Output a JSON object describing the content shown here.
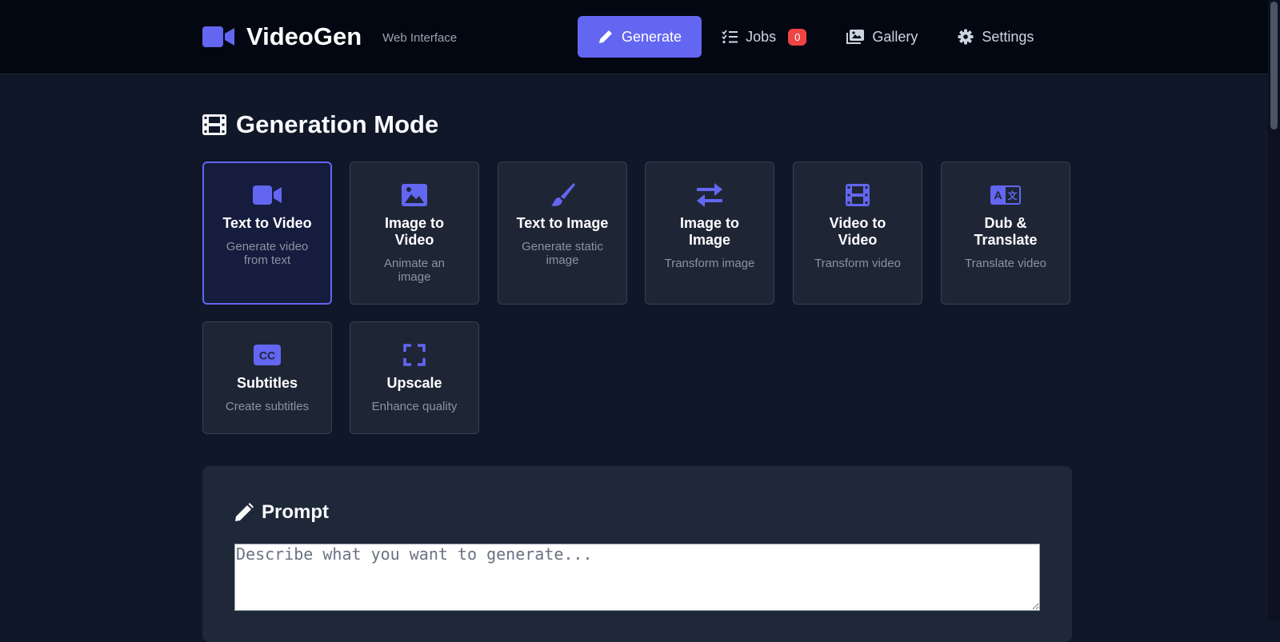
{
  "brand": {
    "title": "VideoGen",
    "subtitle": "Web Interface"
  },
  "nav": [
    {
      "label": "Generate",
      "icon": "pencil-icon",
      "active": true
    },
    {
      "label": "Jobs",
      "icon": "tasks-icon",
      "badge": "0"
    },
    {
      "label": "Gallery",
      "icon": "images-icon"
    },
    {
      "label": "Settings",
      "icon": "gear-icon"
    }
  ],
  "section": {
    "title": "Generation Mode",
    "icon": "film-icon"
  },
  "modes": [
    {
      "label": "Text to Video",
      "desc": "Generate video from text",
      "icon": "video-camera-icon",
      "selected": true
    },
    {
      "label": "Image to Video",
      "desc": "Animate an image",
      "icon": "image-icon"
    },
    {
      "label": "Text to Image",
      "desc": "Generate static image",
      "icon": "paintbrush-icon"
    },
    {
      "label": "Image to Image",
      "desc": "Transform image",
      "icon": "exchange-arrows-icon"
    },
    {
      "label": "Video to Video",
      "desc": "Transform video",
      "icon": "film-icon"
    },
    {
      "label": "Dub & Translate",
      "desc": "Translate video",
      "icon": "language-icon"
    },
    {
      "label": "Subtitles",
      "desc": "Create subtitles",
      "icon": "closed-captions-icon"
    },
    {
      "label": "Upscale",
      "desc": "Enhance quality",
      "icon": "expand-icon"
    }
  ],
  "prompt": {
    "title": "Prompt",
    "icon": "pencil-icon",
    "value": "",
    "placeholder": "Describe what you want to generate..."
  },
  "colors": {
    "accent": "#6366f1",
    "badge": "#ef4444",
    "background": "#0f1729",
    "header": "#030712"
  }
}
